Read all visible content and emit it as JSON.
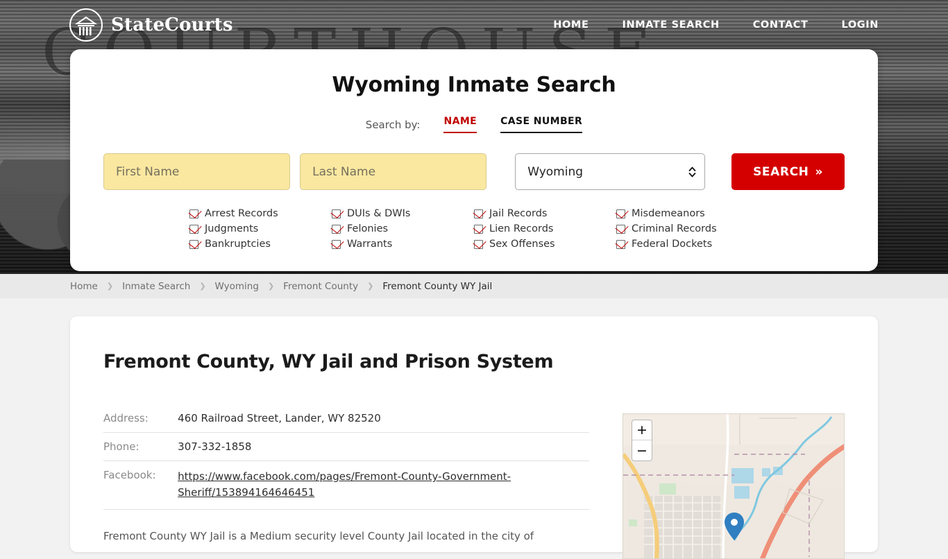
{
  "header": {
    "brand_name": "StateCourts",
    "brand_icon": "courthouse-icon",
    "background_word": "COURTHOUSE",
    "nav": [
      {
        "label": "HOME"
      },
      {
        "label": "INMATE SEARCH"
      },
      {
        "label": "CONTACT"
      },
      {
        "label": "LOGIN"
      }
    ]
  },
  "search_card": {
    "title": "Wyoming Inmate Search",
    "search_by_label": "Search by:",
    "tabs": [
      {
        "label": "NAME",
        "active": true
      },
      {
        "label": "CASE NUMBER",
        "active": false
      }
    ],
    "first_name_placeholder": "First Name",
    "first_name_value": "",
    "last_name_placeholder": "Last Name",
    "last_name_value": "",
    "state_value": "Wyoming",
    "search_button": "SEARCH",
    "search_button_chevron": "»",
    "checkbox_items": [
      "Arrest Records",
      "DUIs & DWIs",
      "Jail Records",
      "Misdemeanors",
      "Judgments",
      "Felonies",
      "Lien Records",
      "Criminal Records",
      "Bankruptcies",
      "Warrants",
      "Sex Offenses",
      "Federal Dockets"
    ],
    "accent_color": "#c00000",
    "button_color": "#d40000",
    "input_color": "#fae8a0"
  },
  "breadcrumb": {
    "separator": "❯",
    "items": [
      {
        "label": "Home",
        "current": false
      },
      {
        "label": "Inmate Search",
        "current": false
      },
      {
        "label": "Wyoming",
        "current": false
      },
      {
        "label": "Fremont County",
        "current": false
      },
      {
        "label": "Fremont County WY Jail",
        "current": true
      }
    ]
  },
  "main": {
    "page_title": "Fremont County, WY Jail and Prison System",
    "details": [
      {
        "label": "Address:",
        "value": "460 Railroad Street, Lander, WY 82520",
        "is_link": false
      },
      {
        "label": "Phone:",
        "value": "307-332-1858",
        "is_link": false
      },
      {
        "label": "Facebook:",
        "value": "https://www.facebook.com/pages/Fremont-County-Government-Sheriff/153894164646451",
        "is_link": true
      }
    ],
    "body_text": "Fremont County WY Jail is a Medium security level County Jail located in the city of"
  },
  "map": {
    "zoom_in_label": "+",
    "zoom_out_label": "−",
    "marker": "location-pin"
  }
}
